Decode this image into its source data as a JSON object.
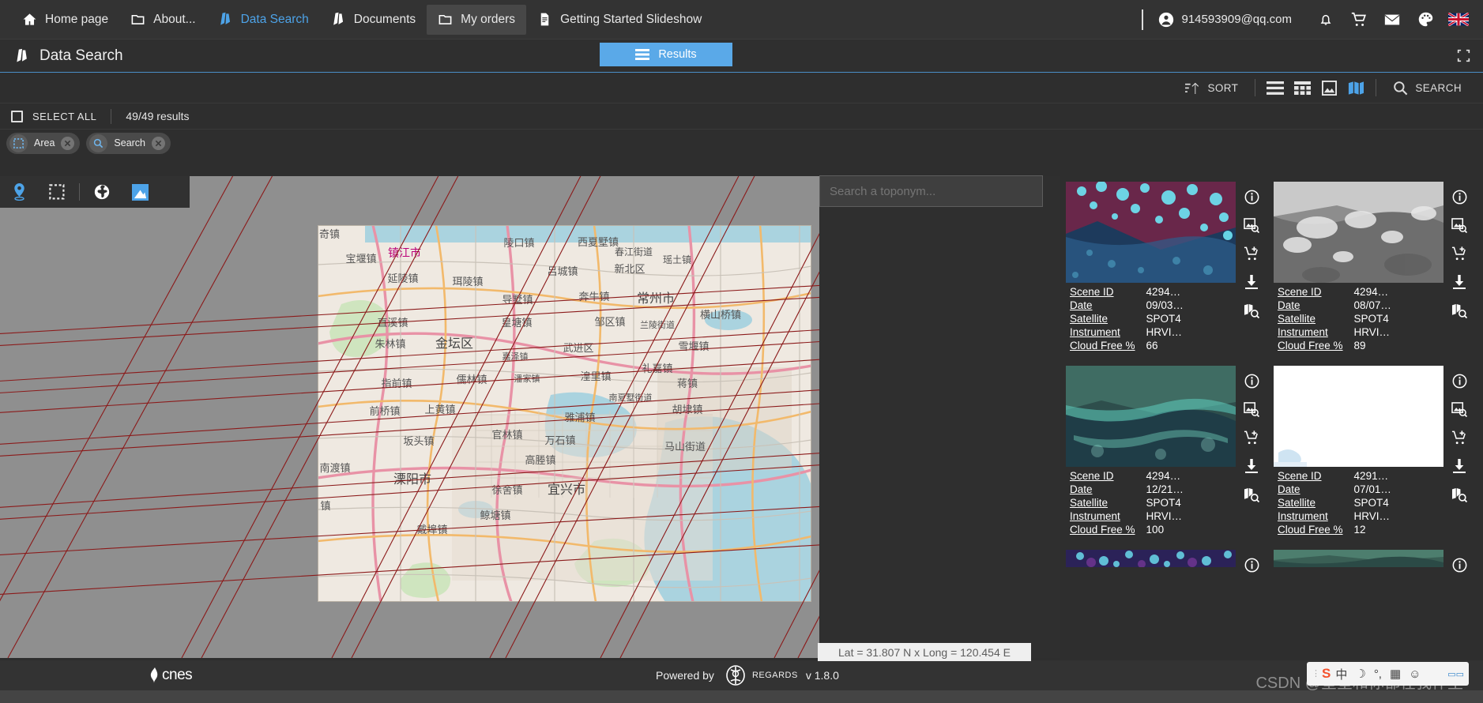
{
  "topnav": {
    "items": [
      {
        "label": "Home page",
        "icon": "home-icon",
        "active": false,
        "highlight": false
      },
      {
        "label": "About...",
        "icon": "folder-icon",
        "active": false,
        "highlight": false
      },
      {
        "label": "Data Search",
        "icon": "data-icon",
        "active": true,
        "highlight": false
      },
      {
        "label": "Documents",
        "icon": "data-icon",
        "active": false,
        "highlight": false
      },
      {
        "label": "My orders",
        "icon": "folder-icon",
        "active": false,
        "highlight": true
      },
      {
        "label": "Getting Started Slideshow",
        "icon": "file-icon",
        "active": false,
        "highlight": false
      }
    ],
    "user_email": "914593909@qq.com",
    "icons": [
      "account-icon",
      "bell-icon",
      "cart-icon",
      "mail-icon",
      "palette-icon",
      "flag-uk-icon"
    ]
  },
  "titlebar": {
    "title": "Data Search",
    "title_icon": "data-icon",
    "results_tab": "Results",
    "results_tab_icon": "list-icon",
    "fullscreen_icon": "fullscreen-icon"
  },
  "toolbar": {
    "sort_label": "SORT",
    "sort_icon": "sort-icon",
    "view_icons": [
      "list-view-icon",
      "table-view-icon",
      "image-view-icon",
      "map-view-icon"
    ],
    "active_view": "map-view-icon",
    "search_label": "SEARCH",
    "search_icon": "search-icon"
  },
  "selection": {
    "select_all_label": "SELECT ALL",
    "results_count": "49/49 results",
    "checkbox_icon": "checkbox-unchecked-icon"
  },
  "chips": [
    {
      "label": "Area",
      "icon": "area-select-icon",
      "remove_icon": "close-icon"
    },
    {
      "label": "Search",
      "icon": "search-icon",
      "remove_icon": "close-icon"
    }
  ],
  "map": {
    "tools": [
      {
        "name": "pin-tool",
        "icon": "map-pin-icon",
        "active": true
      },
      {
        "name": "rectangle-tool",
        "icon": "dashed-rectangle-icon",
        "active": false
      },
      {
        "name": "globe-tool",
        "icon": "globe-icon",
        "active": false
      },
      {
        "name": "layers-tool",
        "icon": "layers-icon",
        "active": true
      }
    ],
    "toponym_placeholder": "Search a toponym...",
    "toponym_value": "",
    "coordinates": "Lat = 31.807 N x Long = 120.454 E",
    "labels": [
      "镇江市",
      "宝堰镇",
      "陵口镇",
      "西夏墅镇",
      "春江街道",
      "吕城镇",
      "新北区",
      "珥陵镇",
      "延陵镇",
      "奔牛镇",
      "瑶土镇",
      "导墅镇",
      "常州市",
      "直溪镇",
      "皇塘镇",
      "邹区镇",
      "朱林镇",
      "金坛区",
      "兰陵街道",
      "横山桥镇",
      "武进区",
      "雪堰镇",
      "指前镇",
      "嘉泽镇",
      "潘家镇",
      "湟里镇",
      "礼嘉镇",
      "南夏墅街道",
      "雅浦镇",
      "胡埭镇",
      "儒林镇",
      "前桥镇",
      "上黄镇",
      "官林镇",
      "马山街道",
      "坡头镇",
      "高塍镇",
      "万石镇",
      "南渡镇",
      "溧阳市",
      "徐舍镇",
      "宜兴市",
      "鲸塘镇",
      "戴埠镇",
      "奇镇"
    ]
  },
  "results": {
    "cards": [
      {
        "thumb_type": "satellite-magenta-cyan",
        "fields": [
          {
            "key": "Scene ID",
            "value": "4294…"
          },
          {
            "key": "Date",
            "value": "09/03…"
          },
          {
            "key": "Satellite",
            "value": "SPOT4"
          },
          {
            "key": "Instrument",
            "value": "HRVI…"
          },
          {
            "key": "Cloud Free %",
            "value": "66"
          }
        ],
        "actions": [
          "info-icon",
          "image-search-icon",
          "add-to-cart-icon",
          "download-icon",
          "map-search-icon"
        ]
      },
      {
        "thumb_type": "satellite-grayscale",
        "fields": [
          {
            "key": "Scene ID",
            "value": "4294…"
          },
          {
            "key": "Date",
            "value": "08/07…"
          },
          {
            "key": "Satellite",
            "value": "SPOT4"
          },
          {
            "key": "Instrument",
            "value": "HRVI…"
          },
          {
            "key": "Cloud Free %",
            "value": "89"
          }
        ],
        "actions": [
          "info-icon",
          "image-search-icon",
          "add-to-cart-icon",
          "download-icon",
          "map-search-icon"
        ]
      },
      {
        "thumb_type": "satellite-teal",
        "fields": [
          {
            "key": "Scene ID",
            "value": "4294…"
          },
          {
            "key": "Date",
            "value": "12/21…"
          },
          {
            "key": "Satellite",
            "value": "SPOT4"
          },
          {
            "key": "Instrument",
            "value": "HRVI…"
          },
          {
            "key": "Cloud Free %",
            "value": "100"
          }
        ],
        "actions": [
          "info-icon",
          "image-search-icon",
          "add-to-cart-icon",
          "download-icon",
          "map-search-icon"
        ]
      },
      {
        "thumb_type": "satellite-white",
        "fields": [
          {
            "key": "Scene ID",
            "value": "4291…"
          },
          {
            "key": "Date",
            "value": "07/01…"
          },
          {
            "key": "Satellite",
            "value": "SPOT4"
          },
          {
            "key": "Instrument",
            "value": "HRVI…"
          },
          {
            "key": "Cloud Free %",
            "value": "12"
          }
        ],
        "actions": [
          "info-icon",
          "image-search-icon",
          "add-to-cart-icon",
          "download-icon",
          "map-search-icon"
        ]
      },
      {
        "thumb_type": "satellite-purple",
        "fields": [],
        "actions": [
          "info-icon"
        ]
      },
      {
        "thumb_type": "satellite-green",
        "fields": [],
        "actions": [
          "info-icon"
        ]
      }
    ]
  },
  "footer": {
    "org": "cnes",
    "powered_by": "Powered by",
    "engine": "REGARDS",
    "version": "v 1.8.0"
  },
  "watermark": {
    "text": "CSDN @星星和你都在我怀里"
  },
  "ime": {
    "logo": "S",
    "items": [
      "中",
      "☽",
      "°,",
      "▦",
      "☺"
    ]
  },
  "colors": {
    "accent": "#5aa9e8",
    "nav_bg": "#333333",
    "panel_bg": "#2e2e2e",
    "map_bg": "#8f8f8f",
    "line_red": "#8b1a1a"
  }
}
